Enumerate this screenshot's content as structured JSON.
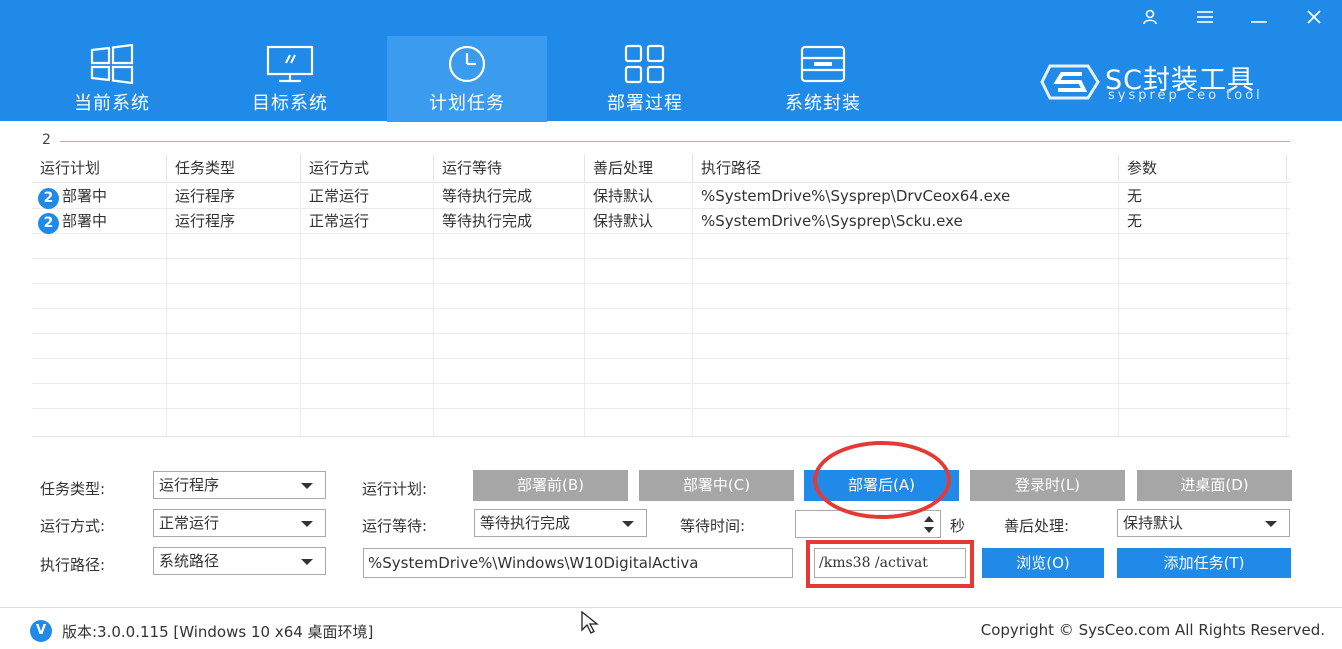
{
  "window": {
    "controls": [
      "user-icon",
      "menu-icon",
      "minimize-icon",
      "close-icon"
    ]
  },
  "nav": {
    "tabs": [
      {
        "label": "当前系统",
        "icon": "windows-icon"
      },
      {
        "label": "目标系统",
        "icon": "monitor-icon"
      },
      {
        "label": "计划任务",
        "icon": "clock-icon",
        "active": true
      },
      {
        "label": "部署过程",
        "icon": "grid-icon"
      },
      {
        "label": "系统封装",
        "icon": "drive-icon"
      }
    ]
  },
  "brand": {
    "title": "SC封装工具",
    "subtitle": "sysprep ceo tool"
  },
  "task_count": "2",
  "table": {
    "headers": [
      "运行计划",
      "任务类型",
      "运行方式",
      "运行等待",
      "善后处理",
      "执行路径",
      "参数"
    ],
    "rows": [
      {
        "badge": "2",
        "plan": "部署中",
        "type": "运行程序",
        "mode": "正常运行",
        "wait": "等待执行完成",
        "after": "保持默认",
        "path": "%SystemDrive%\\Sysprep\\DrvCeox64.exe",
        "params": "无"
      },
      {
        "badge": "2",
        "plan": "部署中",
        "type": "运行程序",
        "mode": "正常运行",
        "wait": "等待执行完成",
        "after": "保持默认",
        "path": "%SystemDrive%\\Sysprep\\Scku.exe",
        "params": "无"
      }
    ]
  },
  "form": {
    "task_type_label": "任务类型:",
    "task_type_value": "运行程序",
    "run_mode_label": "运行方式:",
    "run_mode_value": "正常运行",
    "exec_path_label": "执行路径:",
    "exec_path_value": "系统路径",
    "run_plan_label": "运行计划:",
    "plan_buttons": [
      {
        "label": "部署前(B)",
        "active": false
      },
      {
        "label": "部署中(C)",
        "active": false
      },
      {
        "label": "部署后(A)",
        "active": true
      },
      {
        "label": "登录时(L)",
        "active": false
      },
      {
        "label": "进桌面(D)",
        "active": false
      }
    ],
    "run_wait_label": "运行等待:",
    "run_wait_value": "等待执行完成",
    "wait_time_label": "等待时间:",
    "wait_time_value": "",
    "seconds_label": "秒",
    "after_label": "善后处理:",
    "after_value": "保持默认",
    "path_input": "%SystemDrive%\\Windows\\W10DigitalActiva",
    "params_input": "/kms38 /activat",
    "browse_label": "浏览(O)",
    "add_task_label": "添加任务(T)"
  },
  "footer": {
    "version_badge": "V",
    "version": "版本:3.0.0.115 [Windows 10 x64 桌面环境]",
    "copyright": "Copyright © SysCeo.com All Rights Reserved."
  },
  "colors": {
    "accent": "#1f8ae8",
    "inactive_button": "#a6a6a6",
    "annotation": "#e53935"
  }
}
